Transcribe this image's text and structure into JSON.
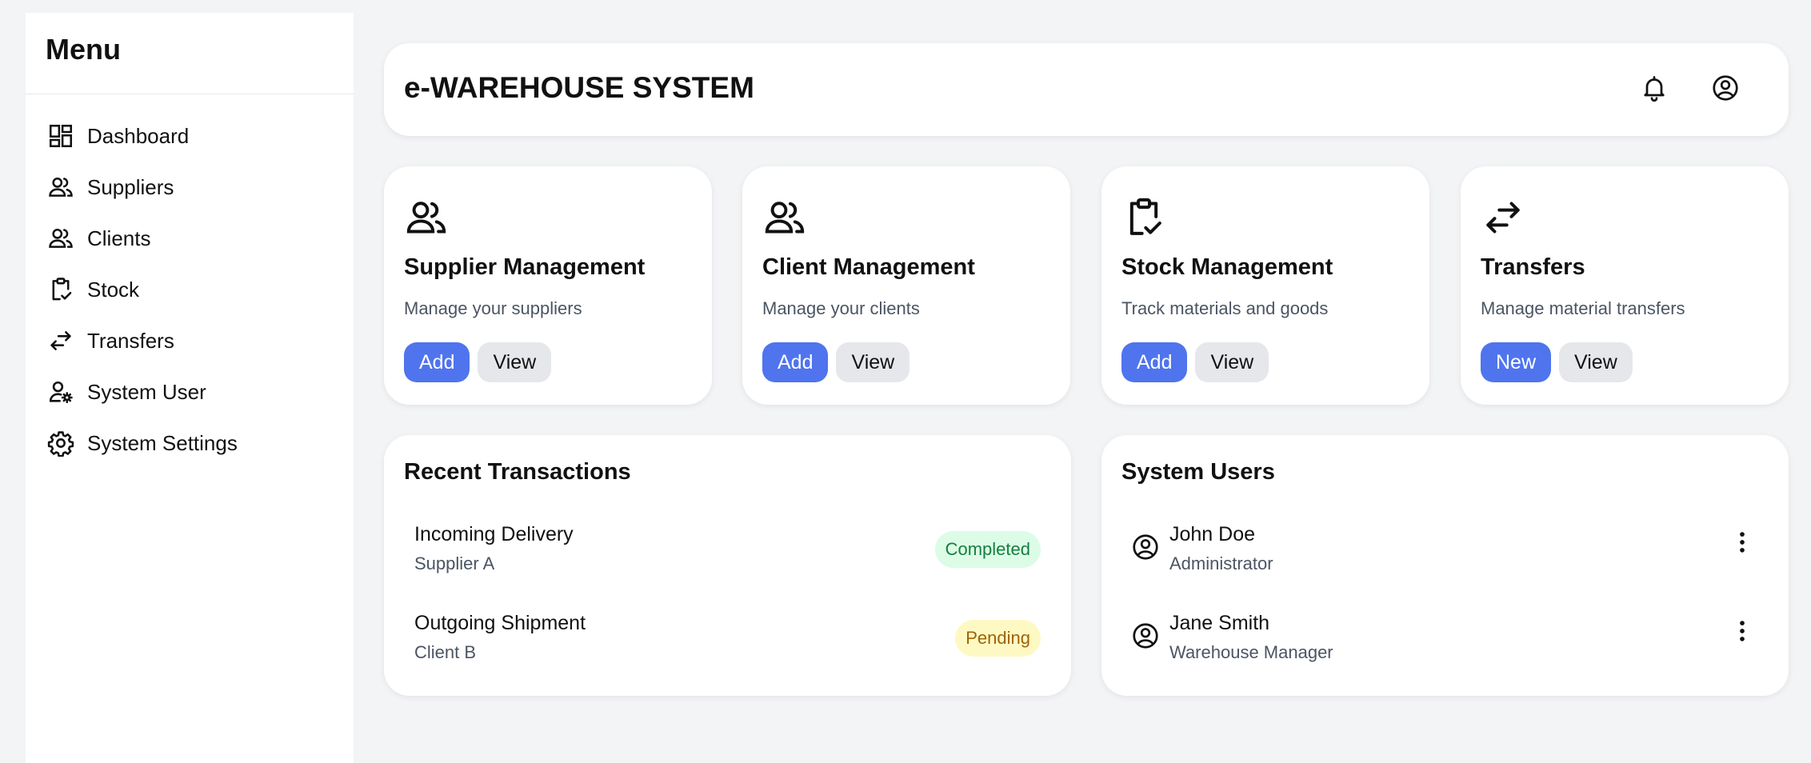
{
  "sidebar": {
    "title": "Menu",
    "items": [
      {
        "label": "Dashboard",
        "icon": "dashboard-icon"
      },
      {
        "label": "Suppliers",
        "icon": "people-icon"
      },
      {
        "label": "Clients",
        "icon": "people-icon"
      },
      {
        "label": "Stock",
        "icon": "clipboard-check-icon"
      },
      {
        "label": "Transfers",
        "icon": "swap-arrows-icon"
      },
      {
        "label": "System User",
        "icon": "user-gear-icon"
      },
      {
        "label": "System Settings",
        "icon": "gear-icon"
      }
    ]
  },
  "header": {
    "title": "e-WAREHOUSE SYSTEM",
    "icons": [
      "bell-icon",
      "account-circle-icon"
    ]
  },
  "cards": [
    {
      "title": "Supplier Management",
      "description": "Manage your suppliers",
      "icon": "people-icon",
      "primary_label": "Add",
      "secondary_label": "View"
    },
    {
      "title": "Client Management",
      "description": "Manage your clients",
      "icon": "people-icon",
      "primary_label": "Add",
      "secondary_label": "View"
    },
    {
      "title": "Stock Management",
      "description": "Track materials and goods",
      "icon": "clipboard-check-icon",
      "primary_label": "Add",
      "secondary_label": "View"
    },
    {
      "title": "Transfers",
      "description": "Manage material transfers",
      "icon": "swap-arrows-icon",
      "primary_label": "New",
      "secondary_label": "View"
    }
  ],
  "transactions": {
    "title": "Recent Transactions",
    "items": [
      {
        "title": "Incoming Delivery",
        "subtitle": "Supplier A",
        "status": "Completed"
      },
      {
        "title": "Outgoing Shipment",
        "subtitle": "Client B",
        "status": "Pending"
      }
    ]
  },
  "users": {
    "title": "System Users",
    "items": [
      {
        "name": "John Doe",
        "role": "Administrator"
      },
      {
        "name": "Jane Smith",
        "role": "Warehouse Manager"
      }
    ]
  },
  "colors": {
    "primary": "#4f74ee",
    "secondary_button": "#e5e7eb",
    "page_background": "#f3f4f6",
    "completed_bg": "#dcfce7",
    "completed_text": "#15803d",
    "pending_bg": "#fef9c3",
    "pending_text": "#a16207"
  }
}
